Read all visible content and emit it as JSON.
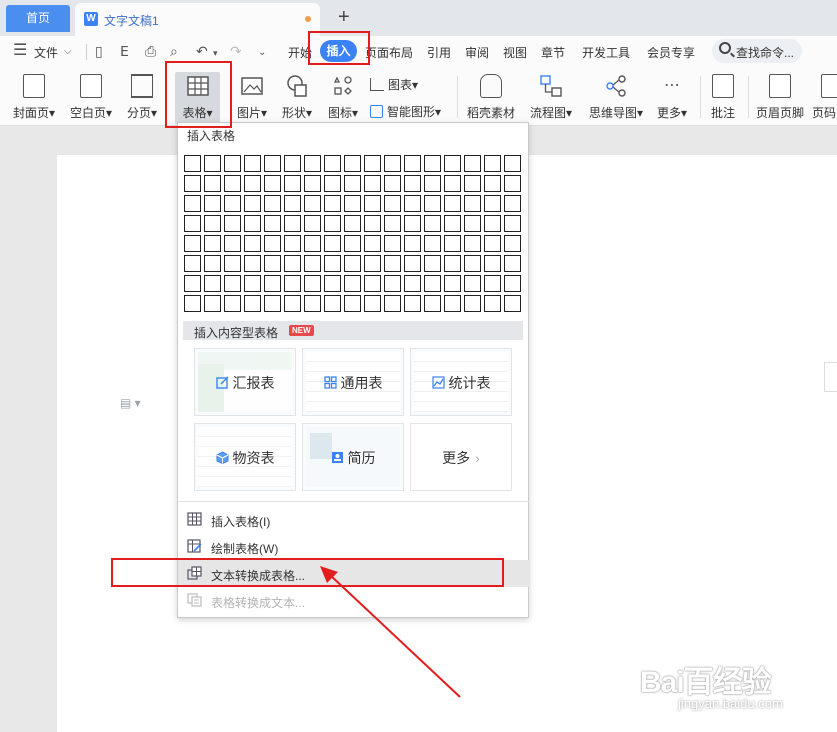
{
  "tabs": {
    "home": "首页",
    "doc_icon": "W",
    "doc_name": "文字文稿1",
    "new_tab": "+"
  },
  "menubar": {
    "hamburger": "☰",
    "file_label": "文件",
    "ribbon_tabs": [
      "开始",
      "插入",
      "页面布局",
      "引用",
      "审阅",
      "视图",
      "章节",
      "开发工具",
      "会员专享"
    ],
    "search_placeholder": "查找命令..."
  },
  "ribbon": {
    "cover": "封面页",
    "blank": "空白页",
    "page_break": "分页",
    "table": "表格",
    "picture": "图片",
    "shape": "形状",
    "icon": "图标",
    "chart": "图表",
    "smart": "智能图形",
    "docer": "稻壳素材",
    "flow": "流程图",
    "mind": "思维导图",
    "more": "更多",
    "comment": "批注",
    "header_footer": "页眉页脚",
    "page_num": "页码"
  },
  "dropdown": {
    "grid_title": "插入表格",
    "grid_rows": 8,
    "grid_cols": 17,
    "content_title": "插入内容型表格",
    "new_badge": "NEW",
    "templates": [
      {
        "label": "汇报表"
      },
      {
        "label": "通用表"
      },
      {
        "label": "统计表"
      },
      {
        "label": "物资表"
      },
      {
        "label": "简历"
      },
      {
        "label": "更多"
      }
    ],
    "items": [
      {
        "label": "插入表格(I)"
      },
      {
        "label": "绘制表格(W)"
      },
      {
        "label": "文本转换成表格..."
      },
      {
        "label": "表格转换成文本..."
      }
    ]
  },
  "watermark": {
    "text": "Bai百经验",
    "url": "jingyan.baidu.com"
  }
}
